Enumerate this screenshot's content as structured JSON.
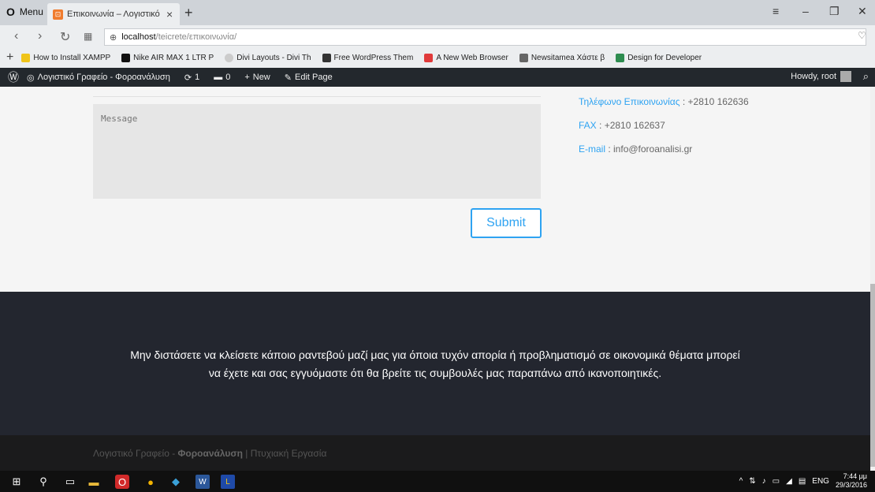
{
  "browser": {
    "menu_label": "Menu",
    "tab_title": "Επικοινωνία – Λογιστικό Γ",
    "new_tab": "+",
    "url_host": "localhost",
    "url_path": "/teicrete/επικοινωνία/",
    "bookmarks": [
      {
        "label": "How to Install XAMPP",
        "color": "#2b2b2b"
      },
      {
        "label": "Nike AIR MAX 1 LTR P",
        "color": "#111111"
      },
      {
        "label": "Divi Layouts - Divi Th",
        "color": "#aaaaaa"
      },
      {
        "label": "Free WordPress Them",
        "color": "#333333"
      },
      {
        "label": "A New Web Browser",
        "color": "#e03a3a"
      },
      {
        "label": "Newsitamea Χάστε β",
        "color": "#555555"
      },
      {
        "label": "Design for Developer",
        "color": "#2d8c4f"
      }
    ]
  },
  "wpbar": {
    "site_name": "Λογιστικό Γραφείο - Φοροανάλυση",
    "updates": "1",
    "comments": "0",
    "new_label": "New",
    "edit_label": "Edit Page",
    "howdy": "Howdy, root"
  },
  "form": {
    "message_placeholder": "Message",
    "submit_label": "Submit"
  },
  "contact": {
    "phone_label": "Τηλέφωνο Επικοινωνίας",
    "phone_value": " : +2810 162636",
    "fax_label": "FAX",
    "fax_value": " : +2810 162637",
    "email_label": "E-mail",
    "email_value": " : info@foroanalisi.gr"
  },
  "cta": {
    "line1": "Μην διστάσετε να κλείσετε κάποιο ραντεβού μαζί μας για όποια τυχόν απορία ή προβληματισμό σε οικονομικά θέματα μπορεί",
    "line2": "να έχετε και σας εγγυόμαστε ότι θα βρείτε τις συμβουλές μας παραπάνω από ικανοποιητικές."
  },
  "footer": {
    "prefix": "Λογιστικό Γραφείο - ",
    "brand": "Φοροανάλυση",
    "suffix": " | Πτυχιακή Εργασία"
  },
  "taskbar": {
    "lang": "ENG",
    "time": "7:44 μμ",
    "date": "29/3/2016"
  }
}
